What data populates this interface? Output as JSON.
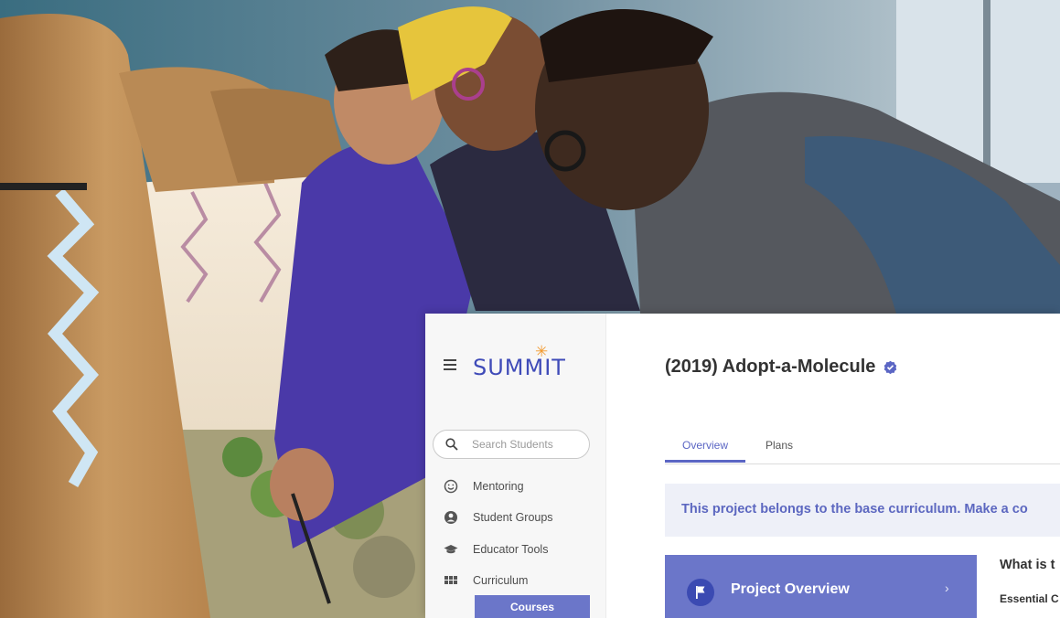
{
  "app": {
    "logo_text": "SUMMIT"
  },
  "sidebar": {
    "search_placeholder": "Search Students",
    "items": [
      {
        "label": "Mentoring",
        "icon": "smiley-icon"
      },
      {
        "label": "Student Groups",
        "icon": "user-circle-icon"
      },
      {
        "label": "Educator Tools",
        "icon": "graduation-cap-icon"
      },
      {
        "label": "Curriculum",
        "icon": "grid-icon"
      }
    ],
    "courses_label": "Courses"
  },
  "main": {
    "title": "(2019) Adopt-a-Molecule",
    "tabs": [
      {
        "label": "Overview",
        "active": true
      },
      {
        "label": "Plans",
        "active": false
      }
    ],
    "banner_text": "This project belongs to the base curriculum. Make a co",
    "overview_card_label": "Project Overview",
    "side_heading": "What is t",
    "side_subheading": "Essential C"
  },
  "colors": {
    "accent": "#6b76c9",
    "accent_dark": "#3b4ab2",
    "logo": "#3f4bb8",
    "logo_star": "#f29a2e",
    "banner_bg": "#eef0f8"
  }
}
